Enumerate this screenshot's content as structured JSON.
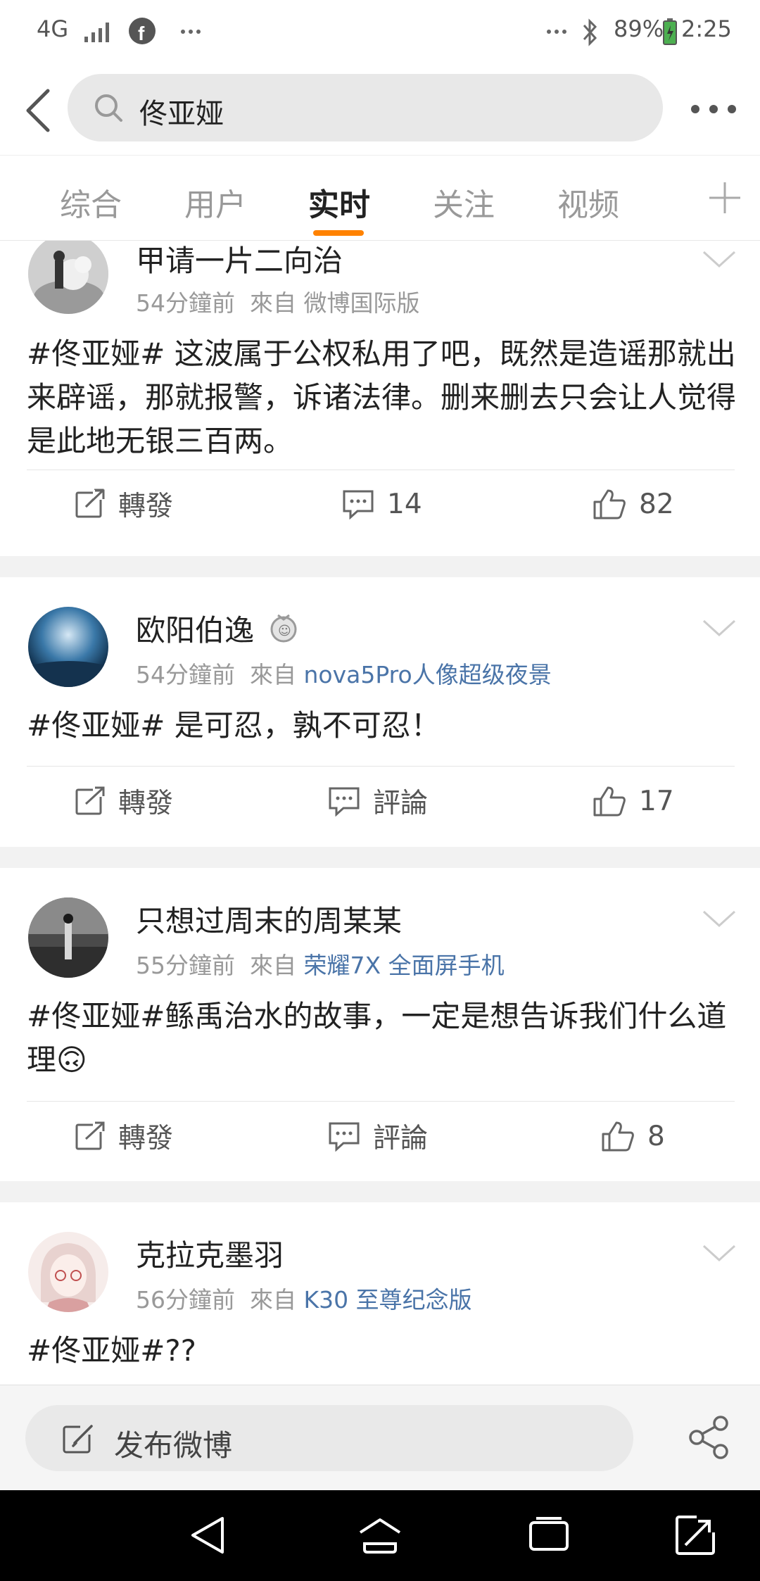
{
  "status_bar": {
    "network": "4G",
    "left_icons": [
      "signal-icon",
      "facebook-icon",
      "more-dots-icon"
    ],
    "battery": "89%",
    "time": "2:25"
  },
  "search": {
    "query": "佟亚娅"
  },
  "tabs": [
    {
      "label": "综合",
      "active": false
    },
    {
      "label": "用户",
      "active": false
    },
    {
      "label": "实时",
      "active": true
    },
    {
      "label": "关注",
      "active": false
    },
    {
      "label": "视频",
      "active": false
    }
  ],
  "posts": [
    {
      "username": "甲请一片二向治",
      "time": "54分鐘前",
      "from_label": "來自",
      "source": "微博国际版",
      "text": "#佟亚娅#  这波属于公权私用了吧，既然是造谣那就出来辟谣，那就报警，诉诸法律。删来删去只会让人觉得是此地无银三百两。",
      "repost_label": "轉發",
      "comment_label": "14",
      "like_count": "82"
    },
    {
      "username": "欧阳伯逸",
      "time": "54分鐘前",
      "from_label": "來自",
      "source": "nova5Pro人像超级夜景",
      "text": "#佟亚娅# 是可忍，孰不可忍！",
      "repost_label": "轉發",
      "comment_label": "評論",
      "like_count": "17"
    },
    {
      "username": "只想过周末的周某某",
      "time": "55分鐘前",
      "from_label": "來自",
      "source": "荣耀7X 全面屏手机",
      "text": "#佟亚娅#鲧禹治水的故事，一定是想告诉我们什么道理🙃",
      "repost_label": "轉發",
      "comment_label": "評論",
      "like_count": "8"
    },
    {
      "username": "克拉克墨羽",
      "time": "56分鐘前",
      "from_label": "來自",
      "source": "K30 至尊纪念版",
      "text": "#佟亚娅#??"
    }
  ],
  "compose": {
    "placeholder": "发布微博"
  },
  "colors": {
    "accent": "#ff8200",
    "source_link": "#4a74a8"
  }
}
